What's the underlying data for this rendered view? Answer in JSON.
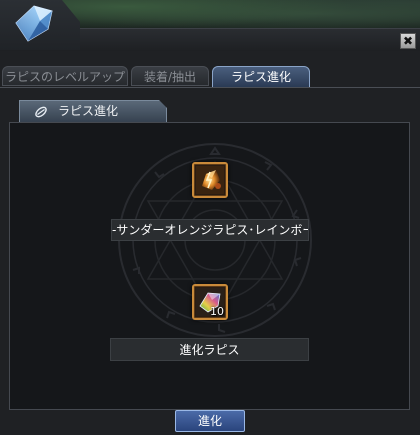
{
  "window": {
    "close_symbol": "✖",
    "emblem_icon": "lapis-crystal-icon",
    "close_icon": "close-icon"
  },
  "tabs": [
    {
      "label": "ラピスのレベルアップ",
      "active": false
    },
    {
      "label": "装着/抽出",
      "active": false
    },
    {
      "label": "ラピス進化",
      "active": true
    }
  ],
  "panel": {
    "header_label": "ラピス進化",
    "header_icon": "lapis-evolution-icon",
    "target_item": {
      "name": "-サンダーオレンジラピス･レインボーシ",
      "icon": "thunder-orange-lapis-icon"
    },
    "material_item": {
      "name": "進化ラピス",
      "count": "10",
      "icon": "rainbow-lapis-icon"
    }
  },
  "footer": {
    "evolve_label": "進化"
  },
  "colors": {
    "accent_tab": "#4a5f7e",
    "slot_border": "#c98a3a",
    "button_bg": "#2a447c"
  }
}
